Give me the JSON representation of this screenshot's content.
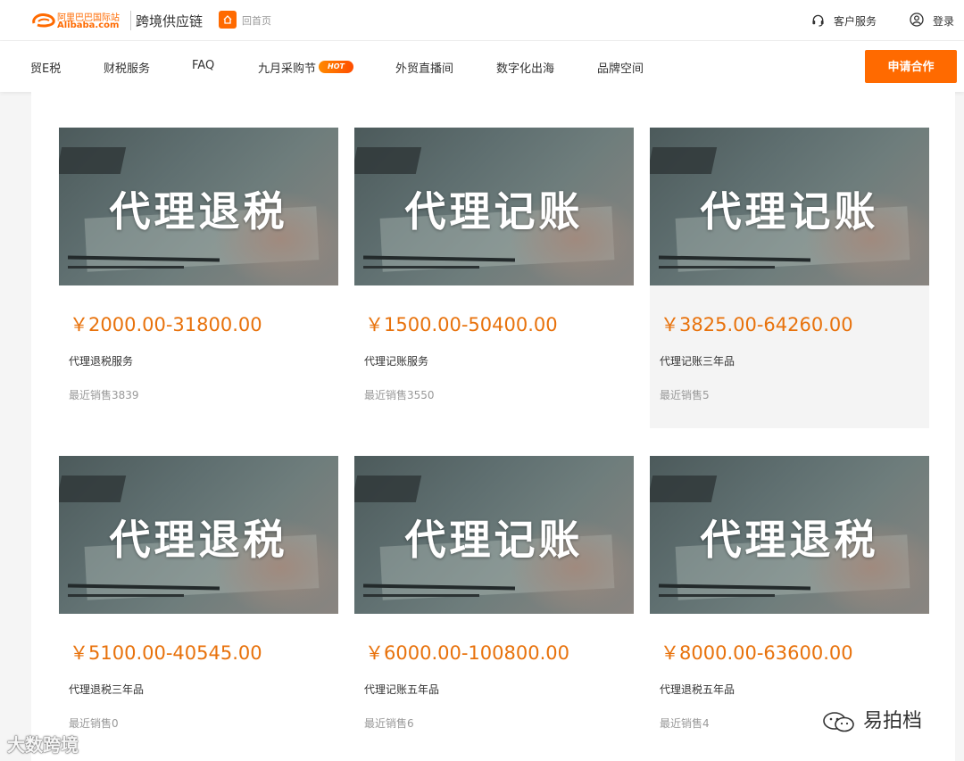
{
  "header": {
    "logo_cn": "阿里巴巴国际站",
    "logo_en": "Alibaba.com",
    "site_title": "跨境供应链",
    "home_link": "回首页",
    "customer_service": "客户服务",
    "login": "登录"
  },
  "nav": {
    "items": [
      "贸E税",
      "财税服务",
      "FAQ",
      "九月采购节",
      "外贸直播间",
      "数字化出海",
      "品牌空间"
    ],
    "hot_badge": "HOT",
    "apply_button": "申请合作"
  },
  "products": [
    {
      "image_text": "代理退税",
      "price": "￥2000.00-31800.00",
      "title": "代理退税服务",
      "sales": "最近销售3839"
    },
    {
      "image_text": "代理记账",
      "price": "￥1500.00-50400.00",
      "title": "代理记账服务",
      "sales": "最近销售3550"
    },
    {
      "image_text": "代理记账",
      "price": "￥3825.00-64260.00",
      "title": "代理记账三年品",
      "sales": "最近销售5"
    },
    {
      "image_text": "代理退税",
      "price": "￥5100.00-40545.00",
      "title": "代理退税三年品",
      "sales": "最近销售0"
    },
    {
      "image_text": "代理记账",
      "price": "￥6000.00-100800.00",
      "title": "代理记账五年品",
      "sales": "最近销售6"
    },
    {
      "image_text": "代理退税",
      "price": "￥8000.00-63600.00",
      "title": "代理退税五年品",
      "sales": "最近销售4"
    }
  ],
  "watermarks": {
    "left": "大数跨境",
    "right": "易拍档"
  },
  "colors": {
    "brand_orange": "#ff6a00",
    "price_orange": "#e8720c"
  }
}
